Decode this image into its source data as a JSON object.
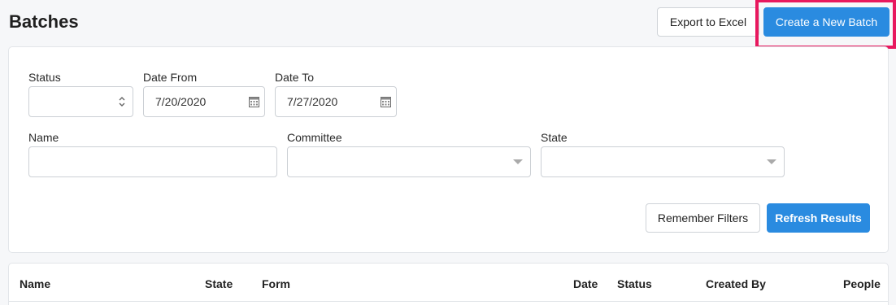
{
  "header": {
    "title": "Batches",
    "export_label": "Export to Excel",
    "create_label": "Create a New Batch",
    "highlight_color": "#e8185e"
  },
  "filters": {
    "status": {
      "label": "Status",
      "value": ""
    },
    "date_from": {
      "label": "Date From",
      "value": "7/20/2020"
    },
    "date_to": {
      "label": "Date To",
      "value": "7/27/2020"
    },
    "name": {
      "label": "Name",
      "value": ""
    },
    "committee": {
      "label": "Committee",
      "value": ""
    },
    "state": {
      "label": "State",
      "value": ""
    },
    "remember_label": "Remember Filters",
    "refresh_label": "Refresh Results"
  },
  "table": {
    "columns": [
      "Name",
      "State",
      "Form",
      "Date",
      "Status",
      "Created By",
      "People"
    ]
  },
  "colors": {
    "primary": "#2a8be0",
    "background": "#f6f7f9"
  },
  "icons": {
    "status_select": "up-down-chevron-icon",
    "date_picker": "calendar-icon",
    "dropdown": "caret-down-icon"
  }
}
